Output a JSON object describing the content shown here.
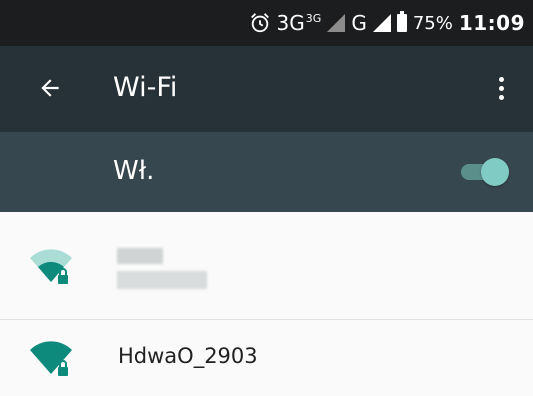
{
  "status_bar": {
    "network_3g": "3G",
    "network_3g_small": "3G",
    "network_g": "G",
    "battery_percent": "75%",
    "time": "11:09",
    "icons": [
      "alarm-icon",
      "signal-icon",
      "battery-icon"
    ]
  },
  "toolbar": {
    "title": "Wi-Fi",
    "back_icon": "arrow-left-icon",
    "menu_icon": "more-vert-icon"
  },
  "switch_bar": {
    "label": "Wł.",
    "enabled": true
  },
  "networks": [
    {
      "ssid": "",
      "secured": true,
      "signal_fraction": 0.5,
      "obscured": true
    },
    {
      "ssid": "HdwaO_2903",
      "secured": true,
      "signal_fraction": 1.0
    }
  ],
  "colors": {
    "status_bar": "#1c1d1f",
    "toolbar": "#263238",
    "switch_bar": "#37474f",
    "accent": "#80cbc4",
    "wifi_icon": "#0e8a7c",
    "wifi_icon_weak": "#a9ddd6"
  }
}
